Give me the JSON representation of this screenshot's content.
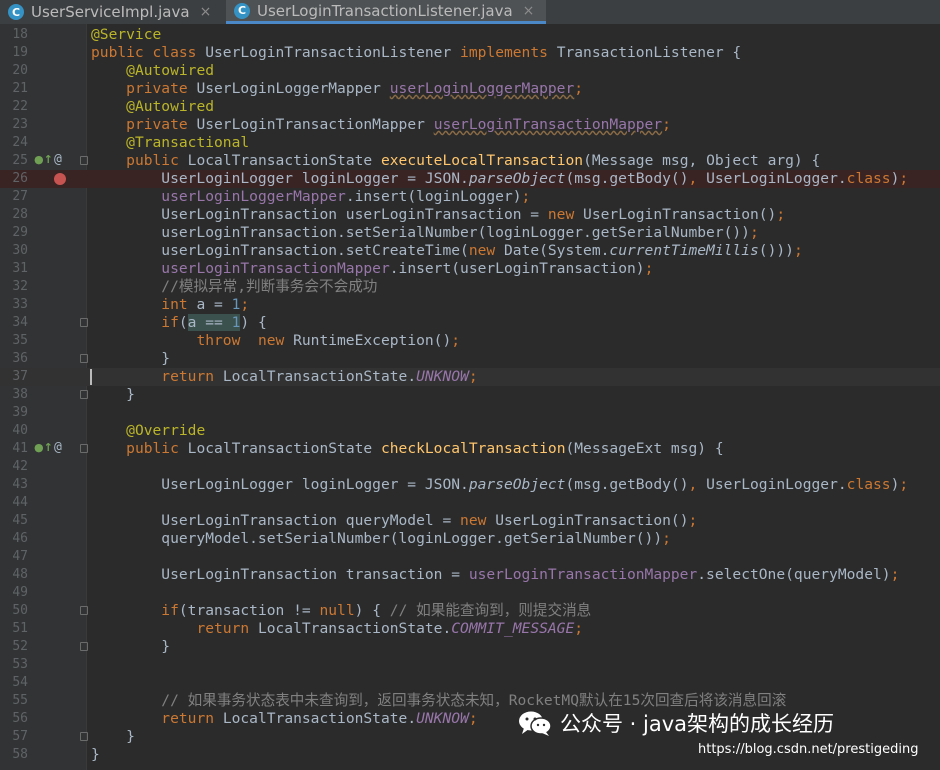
{
  "tabs": [
    {
      "label": "UserServiceImpl.java",
      "active": false,
      "icon": "class-icon"
    },
    {
      "label": "UserLoginTransactionListener.java",
      "active": true,
      "icon": "class-icon"
    }
  ],
  "class_icon_letter": "C",
  "close_glyph": "×",
  "current_line": 37,
  "lines": [
    {
      "n": "18",
      "t": [
        [
          "ann",
          "@Service"
        ]
      ]
    },
    {
      "n": "19",
      "t": [
        [
          "kw",
          "public class "
        ],
        [
          "",
          "UserLoginTransactionListener "
        ],
        [
          "kw",
          "implements "
        ],
        [
          "",
          "TransactionListener {"
        ]
      ]
    },
    {
      "n": "20",
      "t": [
        [
          "",
          "    "
        ],
        [
          "ann",
          "@Autowired"
        ]
      ]
    },
    {
      "n": "21",
      "t": [
        [
          "",
          "    "
        ],
        [
          "kw",
          "private "
        ],
        [
          "",
          "UserLoginLoggerMapper "
        ],
        [
          "und",
          "userLoginLoggerMapper"
        ],
        [
          "kw",
          ";"
        ]
      ]
    },
    {
      "n": "22",
      "t": [
        [
          "",
          "    "
        ],
        [
          "ann",
          "@Autowired"
        ]
      ]
    },
    {
      "n": "23",
      "t": [
        [
          "",
          "    "
        ],
        [
          "kw",
          "private "
        ],
        [
          "",
          "UserLoginTransactionMapper "
        ],
        [
          "und",
          "userLoginTransactionMapper"
        ],
        [
          "kw",
          ";"
        ]
      ]
    },
    {
      "n": "24",
      "t": [
        [
          "",
          "    "
        ],
        [
          "ann",
          "@Transactional"
        ]
      ]
    },
    {
      "n": "25",
      "t": [
        [
          "",
          "    "
        ],
        [
          "kw",
          "public "
        ],
        [
          "",
          "LocalTransactionState "
        ],
        [
          "fn",
          "executeLocalTransaction"
        ],
        [
          "",
          "(Message msg, Object arg) {"
        ]
      ]
    },
    {
      "n": "26",
      "t": [
        [
          "",
          "        UserLoginLogger loginLogger = JSON."
        ],
        [
          "it",
          "parseObject"
        ],
        [
          "",
          "(msg.getBody()"
        ],
        [
          "kw",
          ", "
        ],
        [
          "",
          "UserLoginLogger."
        ],
        [
          "kw",
          "class"
        ],
        [
          "",
          ")"
        ],
        [
          "kw",
          ";"
        ]
      ]
    },
    {
      "n": "27",
      "t": [
        [
          "",
          "        "
        ],
        [
          "fld",
          "userLoginLoggerMapper"
        ],
        [
          "",
          ".insert(loginLogger)"
        ],
        [
          "kw",
          ";"
        ]
      ]
    },
    {
      "n": "28",
      "t": [
        [
          "",
          "        UserLoginTransaction userLoginTransaction = "
        ],
        [
          "kw",
          "new "
        ],
        [
          "",
          "UserLoginTransaction()"
        ],
        [
          "kw",
          ";"
        ]
      ]
    },
    {
      "n": "29",
      "t": [
        [
          "",
          "        userLoginTransaction.setSerialNumber(loginLogger.getSerialNumber())"
        ],
        [
          "kw",
          ";"
        ]
      ]
    },
    {
      "n": "30",
      "t": [
        [
          "",
          "        userLoginTransaction.setCreateTime("
        ],
        [
          "kw",
          "new "
        ],
        [
          "",
          "Date(System."
        ],
        [
          "it",
          "currentTimeMillis"
        ],
        [
          "",
          "()))"
        ],
        [
          "kw",
          ";"
        ]
      ]
    },
    {
      "n": "31",
      "t": [
        [
          "",
          "        "
        ],
        [
          "fld",
          "userLoginTransactionMapper"
        ],
        [
          "",
          ".insert(userLoginTransaction)"
        ],
        [
          "kw",
          ";"
        ]
      ]
    },
    {
      "n": "32",
      "t": [
        [
          "",
          "        "
        ],
        [
          "cmt",
          "//模拟异常,判断事务会不会成功"
        ]
      ]
    },
    {
      "n": "33",
      "t": [
        [
          "",
          "        "
        ],
        [
          "kw",
          "int "
        ],
        [
          "",
          "a = "
        ],
        [
          "num",
          "1"
        ],
        [
          "kw",
          ";"
        ]
      ]
    },
    {
      "n": "34",
      "t": [
        [
          "",
          "        "
        ],
        [
          "kw",
          "if"
        ],
        [
          "",
          "("
        ],
        [
          "hl",
          "a == "
        ],
        [
          "num hl",
          "1"
        ],
        [
          "",
          ") {"
        ]
      ]
    },
    {
      "n": "35",
      "t": [
        [
          "",
          "            "
        ],
        [
          "kw",
          "throw  new "
        ],
        [
          "",
          "RuntimeException()"
        ],
        [
          "kw",
          ";"
        ]
      ]
    },
    {
      "n": "36",
      "t": [
        [
          "",
          "        }"
        ]
      ]
    },
    {
      "n": "37",
      "t": [
        [
          "",
          "        "
        ],
        [
          "kw",
          "return "
        ],
        [
          "",
          "LocalTransactionState."
        ],
        [
          "cst",
          "UNKNOW"
        ],
        [
          "kw",
          ";"
        ]
      ]
    },
    {
      "n": "38",
      "t": [
        [
          "",
          "    }"
        ]
      ]
    },
    {
      "n": "39",
      "t": []
    },
    {
      "n": "40",
      "t": [
        [
          "",
          "    "
        ],
        [
          "ann",
          "@Override"
        ]
      ]
    },
    {
      "n": "41",
      "t": [
        [
          "",
          "    "
        ],
        [
          "kw",
          "public "
        ],
        [
          "",
          "LocalTransactionState "
        ],
        [
          "fn",
          "checkLocalTransaction"
        ],
        [
          "",
          "(MessageExt msg) {"
        ]
      ]
    },
    {
      "n": "42",
      "t": []
    },
    {
      "n": "43",
      "t": [
        [
          "",
          "        UserLoginLogger loginLogger = JSON."
        ],
        [
          "it",
          "parseObject"
        ],
        [
          "",
          "(msg.getBody()"
        ],
        [
          "kw",
          ", "
        ],
        [
          "",
          "UserLoginLogger."
        ],
        [
          "kw",
          "class"
        ],
        [
          "",
          ")"
        ],
        [
          "kw",
          ";"
        ]
      ]
    },
    {
      "n": "44",
      "t": []
    },
    {
      "n": "45",
      "t": [
        [
          "",
          "        UserLoginTransaction queryModel = "
        ],
        [
          "kw",
          "new "
        ],
        [
          "",
          "UserLoginTransaction()"
        ],
        [
          "kw",
          ";"
        ]
      ]
    },
    {
      "n": "46",
      "t": [
        [
          "",
          "        queryModel.setSerialNumber(loginLogger.getSerialNumber())"
        ],
        [
          "kw",
          ";"
        ]
      ]
    },
    {
      "n": "47",
      "t": []
    },
    {
      "n": "48",
      "t": [
        [
          "",
          "        UserLoginTransaction transaction = "
        ],
        [
          "fld",
          "userLoginTransactionMapper"
        ],
        [
          "",
          ".selectOne(queryModel)"
        ],
        [
          "kw",
          ";"
        ]
      ]
    },
    {
      "n": "49",
      "t": []
    },
    {
      "n": "50",
      "t": [
        [
          "",
          "        "
        ],
        [
          "kw",
          "if"
        ],
        [
          "",
          "(transaction != "
        ],
        [
          "kw",
          "null"
        ],
        [
          "",
          ") { "
        ],
        [
          "cmt",
          "// 如果能查询到，则提交消息"
        ]
      ]
    },
    {
      "n": "51",
      "t": [
        [
          "",
          "            "
        ],
        [
          "kw",
          "return "
        ],
        [
          "",
          "LocalTransactionState."
        ],
        [
          "cst",
          "COMMIT_MESSAGE"
        ],
        [
          "kw",
          ";"
        ]
      ]
    },
    {
      "n": "52",
      "t": [
        [
          "",
          "        }"
        ]
      ]
    },
    {
      "n": "53",
      "t": []
    },
    {
      "n": "54",
      "t": []
    },
    {
      "n": "55",
      "t": [
        [
          "",
          "        "
        ],
        [
          "cmt",
          "// 如果事务状态表中未查询到，返回事务状态未知，RocketMQ默认在15次回查后将该消息回滚"
        ]
      ]
    },
    {
      "n": "56",
      "t": [
        [
          "",
          "        "
        ],
        [
          "kw",
          "return "
        ],
        [
          "",
          "LocalTransactionState."
        ],
        [
          "cst",
          "UNKNOW"
        ],
        [
          "kw",
          ";"
        ]
      ]
    },
    {
      "n": "57",
      "t": [
        [
          "",
          "    }"
        ]
      ]
    },
    {
      "n": "58",
      "t": [
        [
          "",
          "}"
        ]
      ]
    }
  ],
  "gutter_marks": {
    "25": [
      "implements-icon",
      "annotation-icon",
      "fold"
    ],
    "26": [
      "breakpoint-icon"
    ],
    "34": [
      "fold"
    ],
    "36": [
      "fold"
    ],
    "38": [
      "fold"
    ],
    "41": [
      "implements-icon",
      "annotation-icon",
      "fold"
    ],
    "50": [
      "fold"
    ],
    "52": [
      "fold"
    ],
    "57": [
      "fold"
    ]
  },
  "watermark": {
    "text": "公众号 · java架构的成长经历",
    "icon": "wechat-icon"
  },
  "source_url": "https://blog.csdn.net/prestigeding"
}
